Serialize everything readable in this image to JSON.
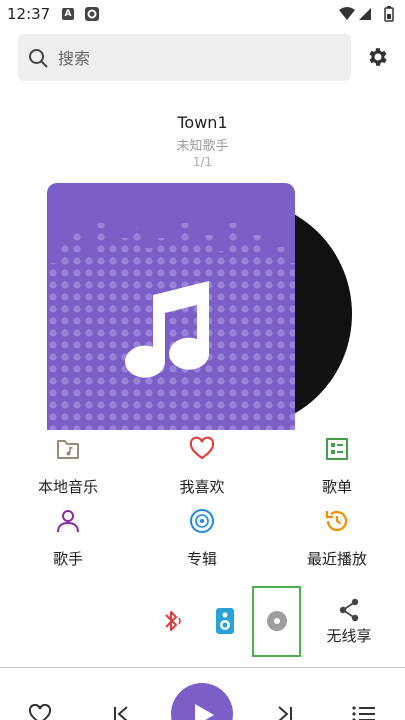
{
  "status": {
    "time": "12:37",
    "icon_a": "A"
  },
  "search": {
    "placeholder": "搜索",
    "value": ""
  },
  "song": {
    "title": "Town1",
    "artist": "未知歌手",
    "index": "1/1"
  },
  "menu": {
    "items": [
      {
        "label": "本地音乐",
        "icon": "folder-music-icon",
        "color": "#9e8a78"
      },
      {
        "label": "我喜欢",
        "icon": "heart-icon",
        "color": "#e53935"
      },
      {
        "label": "歌单",
        "icon": "playlist-icon",
        "color": "#43a047"
      },
      {
        "label": "歌手",
        "icon": "person-icon",
        "color": "#8e24aa"
      },
      {
        "label": "专辑",
        "icon": "album-icon",
        "color": "#1e88e5"
      },
      {
        "label": "最近播放",
        "icon": "history-icon",
        "color": "#fb8c00"
      }
    ]
  },
  "tools": {
    "share_label": "无线享"
  },
  "colors": {
    "accent": "#7b5fc7",
    "selection": "#4caf50"
  }
}
